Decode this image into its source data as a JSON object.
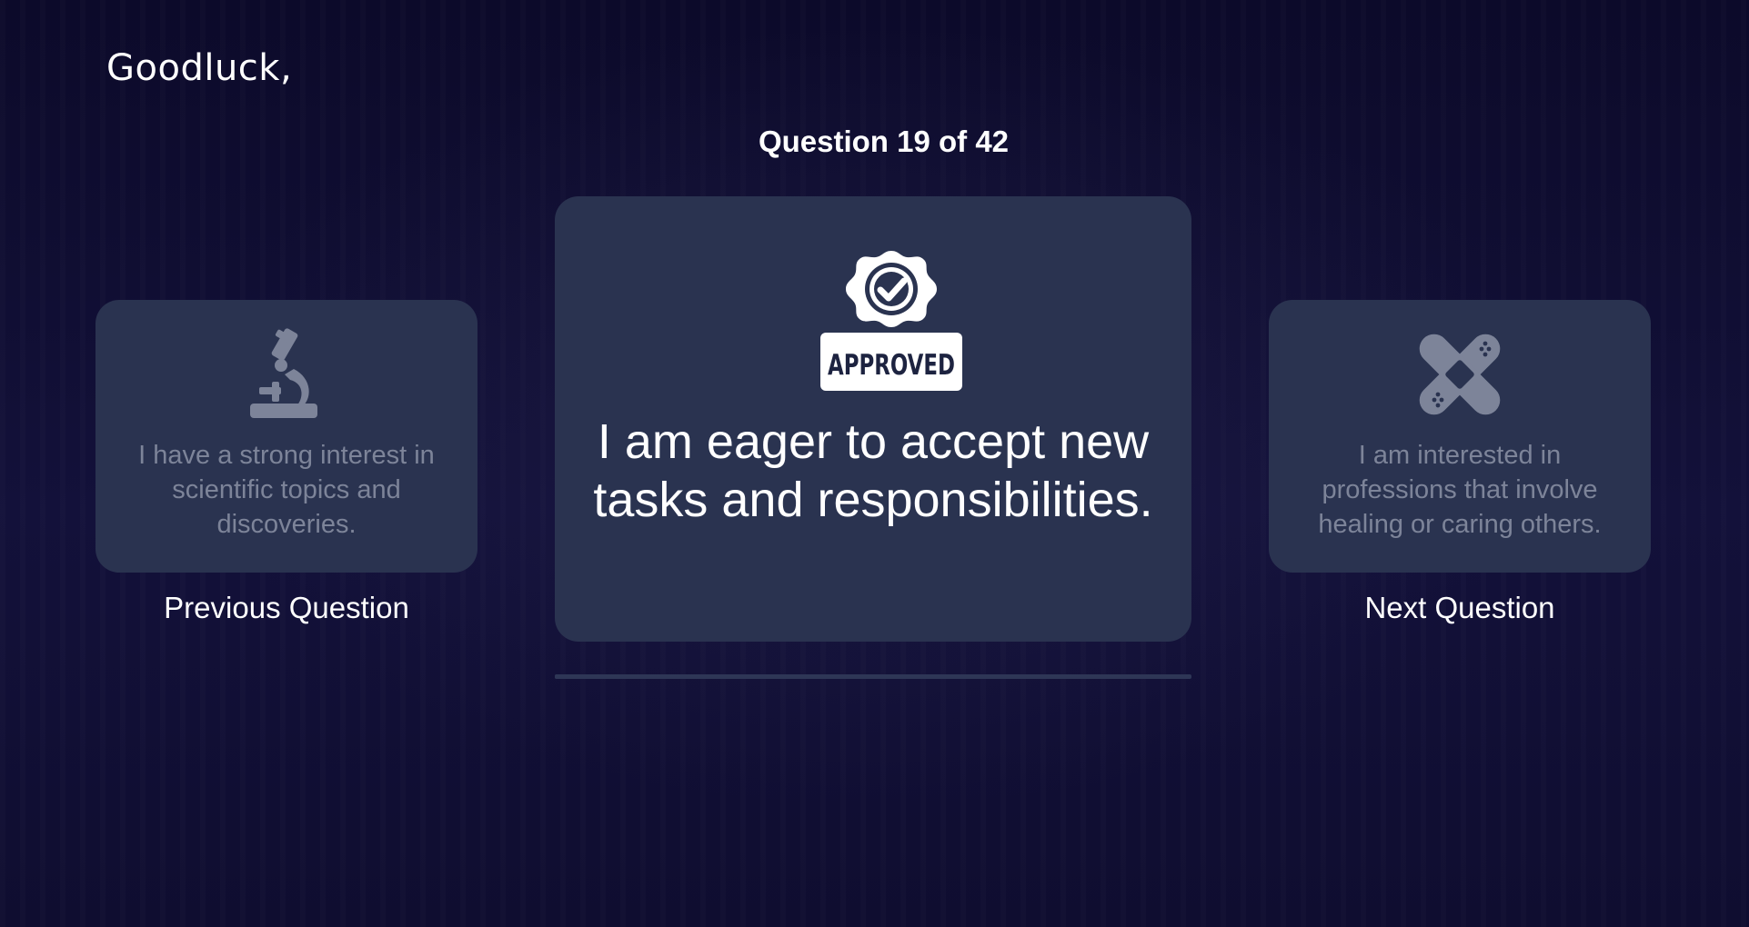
{
  "greeting": "Goodluck,",
  "counter": "Question 19 of 42",
  "progress": {
    "current": 19,
    "total": 42
  },
  "current_question": {
    "text": "I am eager to accept new tasks and responsibilities.",
    "icon": "approved-badge-icon",
    "badge_text": "APPROVED"
  },
  "previous_question": {
    "text": "I have a strong interest in scientific topics and discoveries.",
    "icon": "microscope-icon",
    "label": "Previous Question"
  },
  "next_question": {
    "text": "I am interested in professions that involve healing or caring others.",
    "icon": "bandage-icon",
    "label": "Next Question"
  },
  "colors": {
    "background": "#0e0c2e",
    "card": "#2a3350",
    "muted_text": "#7d8499",
    "text": "#ffffff"
  }
}
